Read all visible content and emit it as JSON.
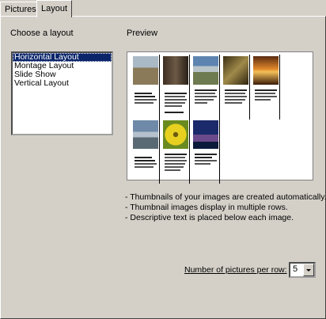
{
  "tabs": [
    {
      "label": "Pictures",
      "selected": false
    },
    {
      "label": "Layout",
      "selected": true
    }
  ],
  "choose_label": "Choose a layout",
  "layouts": [
    {
      "label": "Horizontal Layout",
      "selected": true
    },
    {
      "label": "Montage Layout",
      "selected": false
    },
    {
      "label": "Slide Show",
      "selected": false
    },
    {
      "label": "Vertical Layout",
      "selected": false
    }
  ],
  "preview_label": "Preview",
  "description": [
    "- Thumbnails of your images are created automatically.",
    "- Thumbnail images display in multiple rows.",
    "- Descriptive text is placed below each image."
  ],
  "pictures_per_row": {
    "label": "Number of pictures per row:",
    "value": "5"
  },
  "thumbnail_colors": [
    "#8a7a5a",
    "#6c5a45",
    "#7d9aaa",
    "#7a6a3a",
    "#c86a22",
    "#6f8aa8",
    "#a8b028",
    "#2a3e7a"
  ]
}
